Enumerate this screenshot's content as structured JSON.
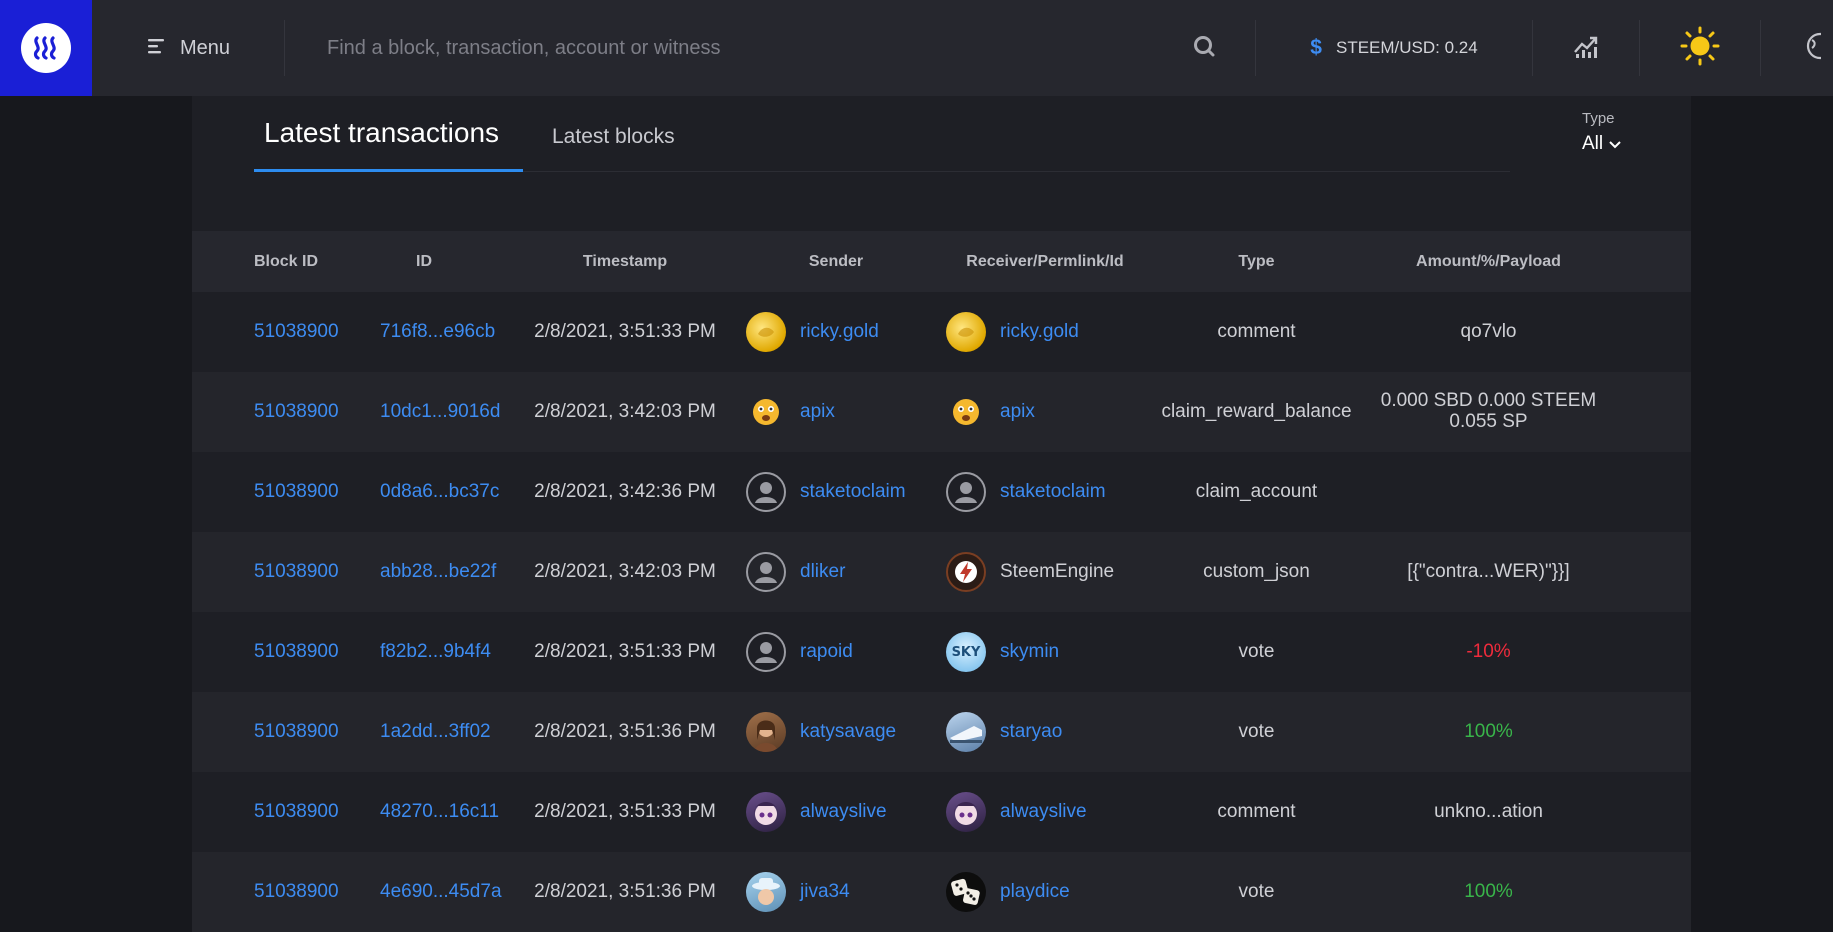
{
  "header": {
    "menu_label": "Menu",
    "search_placeholder": "Find a block, transaction, account or witness",
    "price_text": "STEEM/USD: 0.24",
    "colors": {
      "logo_bg": "#1a1fd6",
      "accent": "#2d8cf0",
      "sun": "#f7c817"
    }
  },
  "tabs": {
    "active": "Latest transactions",
    "inactive": "Latest blocks"
  },
  "filter": {
    "label": "Type",
    "value": "All"
  },
  "table": {
    "headers": [
      "Block ID",
      "ID",
      "Timestamp",
      "Sender",
      "Receiver/Permlink/Id",
      "Type",
      "Amount/%/Payload"
    ],
    "rows": [
      {
        "block": "51038900",
        "id": "716f8...e96cb",
        "time": "2/8/2021, 3:51:33 PM",
        "sender": "ricky.gold",
        "sender_avatar": "gold-coin",
        "receiver": "ricky.gold",
        "receiver_avatar": "gold-coin",
        "receiver_link": true,
        "type": "comment",
        "amount": "qo7vlo",
        "amount_style": "plain"
      },
      {
        "block": "51038900",
        "id": "10dc1...9016d",
        "time": "2/8/2021, 3:42:03 PM",
        "sender": "apix",
        "sender_avatar": "emoji",
        "receiver": "apix",
        "receiver_avatar": "emoji",
        "receiver_link": true,
        "type": "claim_reward_balance",
        "amount": "0.000 SBD 0.000 STEEM 0.055 SP",
        "amount_style": "plain"
      },
      {
        "block": "51038900",
        "id": "0d8a6...bc37c",
        "time": "2/8/2021, 3:42:36 PM",
        "sender": "staketoclaim",
        "sender_avatar": "default",
        "receiver": "staketoclaim",
        "receiver_avatar": "default",
        "receiver_link": true,
        "type": "claim_account",
        "amount": "",
        "amount_style": "plain"
      },
      {
        "block": "51038900",
        "id": "abb28...be22f",
        "time": "2/8/2021, 3:42:03 PM",
        "sender": "dliker",
        "sender_avatar": "default",
        "receiver": "SteemEngine",
        "receiver_avatar": "engine",
        "receiver_link": false,
        "type": "custom_json",
        "amount": "[{\"contra...WER)\"}}]",
        "amount_style": "plain"
      },
      {
        "block": "51038900",
        "id": "f82b2...9b4f4",
        "time": "2/8/2021, 3:51:33 PM",
        "sender": "rapoid",
        "sender_avatar": "default",
        "receiver": "skymin",
        "receiver_avatar": "sky",
        "receiver_link": true,
        "type": "vote",
        "amount": "-10%",
        "amount_style": "neg"
      },
      {
        "block": "51038900",
        "id": "1a2dd...3ff02",
        "time": "2/8/2021, 3:51:36 PM",
        "sender": "katysavage",
        "sender_avatar": "person",
        "receiver": "staryao",
        "receiver_avatar": "train",
        "receiver_link": true,
        "type": "vote",
        "amount": "100%",
        "amount_style": "pos"
      },
      {
        "block": "51038900",
        "id": "48270...16c11",
        "time": "2/8/2021, 3:51:33 PM",
        "sender": "alwayslive",
        "sender_avatar": "anime",
        "receiver": "alwayslive",
        "receiver_avatar": "anime",
        "receiver_link": true,
        "type": "comment",
        "amount": "unkno...ation",
        "amount_style": "plain"
      },
      {
        "block": "51038900",
        "id": "4e690...45d7a",
        "time": "2/8/2021, 3:51:36 PM",
        "sender": "jiva34",
        "sender_avatar": "hat",
        "receiver": "playdice",
        "receiver_avatar": "dice",
        "receiver_link": true,
        "type": "vote",
        "amount": "100%",
        "amount_style": "pos"
      }
    ]
  }
}
